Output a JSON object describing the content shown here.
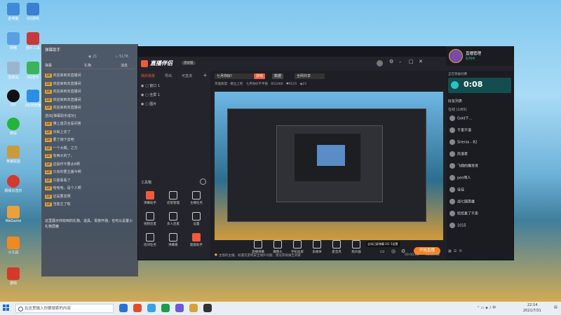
{
  "desktop": {
    "icons": [
      {
        "label": "此电脑",
        "color": "#3f8bd6"
      },
      {
        "label": "QQ游戏",
        "color": "#3a7fd0"
      },
      {
        "label": "网络",
        "color": "#5aa0e0"
      },
      {
        "label": "图片工具",
        "color": "#c53a3a"
      },
      {
        "label": "回收站",
        "color": "#9bb6cc"
      },
      {
        "label": "QQ音乐",
        "color": "#3bb35a"
      },
      {
        "label": "QQ",
        "color": "#111"
      },
      {
        "label": "QQ浏览器",
        "color": "#2d8ee6"
      },
      {
        "label": "微信",
        "color": "#23b53a"
      },
      {
        "label": "英雄联盟",
        "color": "#c89b3c"
      },
      {
        "label": "网易云音乐",
        "color": "#d23a2a"
      },
      {
        "label": "WeGame",
        "color": "#e8a23a"
      },
      {
        "label": "小工具",
        "color": "#f08a1f"
      },
      {
        "label": "游戏",
        "color": "#d4392a"
      }
    ]
  },
  "chat": {
    "title": "弹幕助手",
    "stats": [
      "21",
      "5178"
    ],
    "tabs": [
      "弹幕",
      "礼物",
      "消息"
    ],
    "messages": [
      {
        "badge": "LV",
        "name": "",
        "text": "欢迎来到本直播间"
      },
      {
        "badge": "LV",
        "name": "",
        "text": "欢迎来到本直播间"
      },
      {
        "badge": "LV",
        "name": "",
        "text": "欢迎来到本直播间"
      },
      {
        "badge": "LV",
        "name": "",
        "text": "欢迎来到本直播间"
      },
      {
        "badge": "LV",
        "name": "",
        "text": "欢迎来到本直播间"
      },
      {
        "badge": "",
        "name": "",
        "text": "送出[弹幕助手成功]"
      },
      {
        "badge": "LV",
        "name": "",
        "text": "懂上首页全是问答"
      },
      {
        "badge": "LV",
        "name": "",
        "text": "对就上去了"
      },
      {
        "badge": "LV",
        "name": "",
        "text": "要了她下去吧"
      },
      {
        "badge": "LV",
        "name": "",
        "text": "一个大概。之力"
      },
      {
        "badge": "LV",
        "name": "",
        "text": "有两大的了。"
      },
      {
        "badge": "LV",
        "name": "",
        "text": "这操作不要太6啊"
      },
      {
        "badge": "LV",
        "name": "",
        "text": "只有你要主播今啊"
      },
      {
        "badge": "LV",
        "name": "",
        "text": "只能看看了"
      },
      {
        "badge": "LV",
        "name": "",
        "text": "哈哈哈。是个人啊"
      },
      {
        "badge": "LV",
        "name": "",
        "text": "还是要发啊"
      },
      {
        "badge": "LV",
        "name": "",
        "text": "当能主了啦"
      }
    ],
    "footer": "这里展示你收到的礼物、道具、贵族开通，也可以设置小礼物屏蔽"
  },
  "app": {
    "brand": "直播伴侣",
    "version": "测试版",
    "left_tabs": [
      "我的场景",
      "导出",
      "可直流"
    ],
    "scenes": [
      "窗口 1",
      "全屏 1",
      "图片"
    ],
    "toolbox_title": "工具箱",
    "tools": [
      "弹幕助手",
      "房管管理",
      "主播任务",
      "视频连麦",
      "多人连麦",
      "设置",
      "房间任务",
      "弹幕看",
      "超级助手"
    ],
    "live_title": "七月你好!",
    "live_tags": [
      "游戏",
      "数据"
    ],
    "live_status": "全网共享",
    "live_meta": [
      "英雄联盟 · 撩出上吧",
      "七月你好不平衡",
      "852466",
      "6535",
      "21"
    ],
    "stream_time": "00:00:00",
    "stream_delay": "01:00:32",
    "bottom_tools": [
      "直播弹幕",
      "摄像头",
      "手机投屏",
      "多媒体",
      "麦克风",
      "扬声器"
    ],
    "start_button": "开始直播",
    "status_text": "主窗的主播，如遇见游戏安全保护问题，建议获取报告到家",
    "tooltip": "全场已屏弹幕  0/1 5设置"
  },
  "right": {
    "user_name": "直播管理",
    "user_sub": "队列中",
    "timer_label": "正在等候付费",
    "timer": "0:08",
    "fans_title": "好友列表",
    "online": "在线 (1/65)",
    "fans": [
      "Gold下...",
      "千里不语",
      "Sirenia - 82",
      "风语者",
      "飞翔的鹰哥哥",
      "pen啊人",
      "佳佳",
      "战七国英雄",
      "挖挖夏了不卖",
      "1015"
    ]
  },
  "taskbar": {
    "search_placeholder": "在这里输入你要搜索的内容",
    "time": "22:14",
    "date": "2021/7/31",
    "app_colors": [
      "#2a6fd6",
      "#e34d2d",
      "#3aa0e8",
      "#1e9b4c",
      "#6b5bd6",
      "#d6a23a",
      "#333"
    ]
  },
  "colors": {
    "accent": "#f6821f",
    "live_red": "#f25a3a",
    "timer_teal": "#27c4c4"
  }
}
